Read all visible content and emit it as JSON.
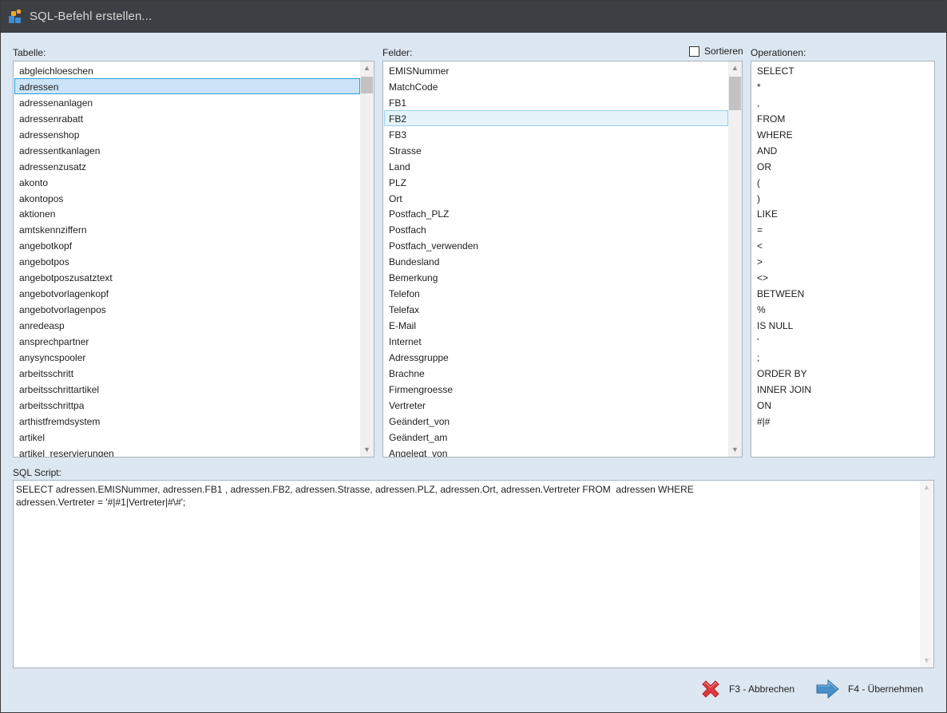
{
  "window": {
    "title": "SQL-Befehl erstellen..."
  },
  "tables": {
    "label": "Tabelle:",
    "items": [
      "abgleichloeschen",
      "adressen",
      "adressenanlagen",
      "adressenrabatt",
      "adressenshop",
      "adressentkanlagen",
      "adressenzusatz",
      "akonto",
      "akontopos",
      "aktionen",
      "amtskennziffern",
      "angebotkopf",
      "angebotpos",
      "angebotposzusatztext",
      "angebotvorlagenkopf",
      "angebotvorlagenpos",
      "anredeasp",
      "ansprechpartner",
      "anysyncspooler",
      "arbeitsschritt",
      "arbeitsschrittartikel",
      "arbeitsschrittpa",
      "arthistfremdsystem",
      "artikel",
      "artikel_reservierungen"
    ],
    "selected": "adressen"
  },
  "fields": {
    "label": "Felder:",
    "sort_label": "Sortieren",
    "sort_checked": false,
    "items": [
      "EMISNummer",
      "MatchCode",
      "FB1",
      "FB2",
      "FB3",
      "Strasse",
      "Land",
      "PLZ",
      "Ort",
      "Postfach_PLZ",
      "Postfach",
      "Postfach_verwenden",
      "Bundesland",
      "Bemerkung",
      "Telefon",
      "Telefax",
      "E-Mail",
      "Internet",
      "Adressgruppe",
      "Brachne",
      "Firmengroesse",
      "Vertreter",
      "Geändert_von",
      "Geändert_am",
      "Angelegt_von"
    ],
    "highlighted": "FB2"
  },
  "operations": {
    "label": "Operationen:",
    "items": [
      "SELECT",
      "*",
      ",",
      "FROM",
      "WHERE",
      "AND",
      "OR",
      "(",
      ")",
      "LIKE",
      "=",
      "<",
      ">",
      "<>",
      "BETWEEN",
      "%",
      "IS NULL",
      "'",
      ";",
      "ORDER BY",
      "INNER JOIN",
      "ON",
      "#|#"
    ]
  },
  "script": {
    "label": "SQL Script:",
    "lines": [
      "SELECT adressen.EMISNummer, adressen.FB1 , adressen.FB2, adressen.Strasse, adressen.PLZ, adressen.Ort, adressen.Vertreter FROM  adressen WHERE",
      "adressen.Vertreter = '#|#1|Vertreter|#\\#';"
    ]
  },
  "buttons": {
    "cancel": "F3 - Abbrechen",
    "apply": "F4 - Übernehmen"
  },
  "colors": {
    "titlebar": "#3c4044",
    "background": "#dde7f1",
    "selection": "#cce4f7",
    "selection_border": "#26a0da",
    "cancel_icon": "#e0393e",
    "apply_icon": "#4a90c8"
  },
  "icons": {
    "app": "app-logo-icon",
    "cancel": "red-x-icon",
    "apply": "blue-arrow-right-icon"
  }
}
